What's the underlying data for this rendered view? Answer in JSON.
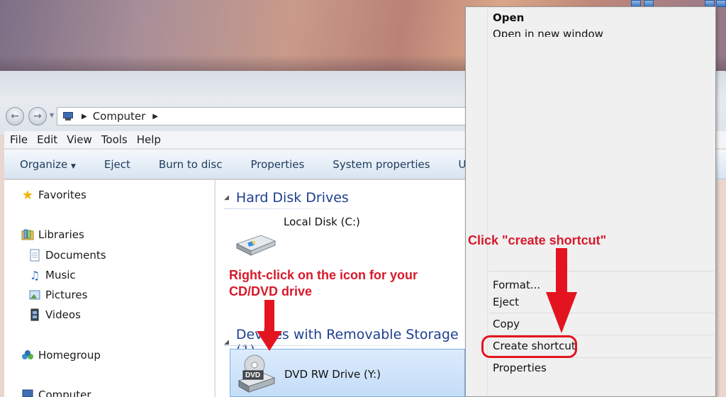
{
  "address_bar": {
    "location": "Computer"
  },
  "menu_bar": [
    "File",
    "Edit",
    "View",
    "Tools",
    "Help"
  ],
  "command_bar": {
    "organize": "Organize",
    "items": [
      "Eject",
      "Burn to disc",
      "Properties",
      "System properties",
      "Uninstall"
    ]
  },
  "nav_pane": {
    "favorites": "Favorites",
    "libraries": "Libraries",
    "library_items": [
      "Documents",
      "Music",
      "Pictures",
      "Videos"
    ],
    "homegroup": "Homegroup",
    "computer": "Computer"
  },
  "content": {
    "hard_disk_group": "Hard Disk Drives",
    "local_disk_label": "Local Disk (C:)",
    "removable_group": "Devices with Removable Storage (1)",
    "dvd_label": "DVD RW Drive (Y:)",
    "dvd_badge": "DVD"
  },
  "context_menu": {
    "open": "Open",
    "open_new_window": "Open in new window",
    "format": "Format...",
    "eject": "Eject",
    "copy": "Copy",
    "create_shortcut": "Create shortcut",
    "properties": "Properties"
  },
  "annotations": {
    "right_click_line1": "Right-click on the icon for your",
    "right_click_line2": "CD/DVD drive",
    "click_create": "Click \"create shortcut\""
  },
  "colors": {
    "annotation_red": "#e3141f",
    "group_header_blue": "#1e3f8f"
  }
}
